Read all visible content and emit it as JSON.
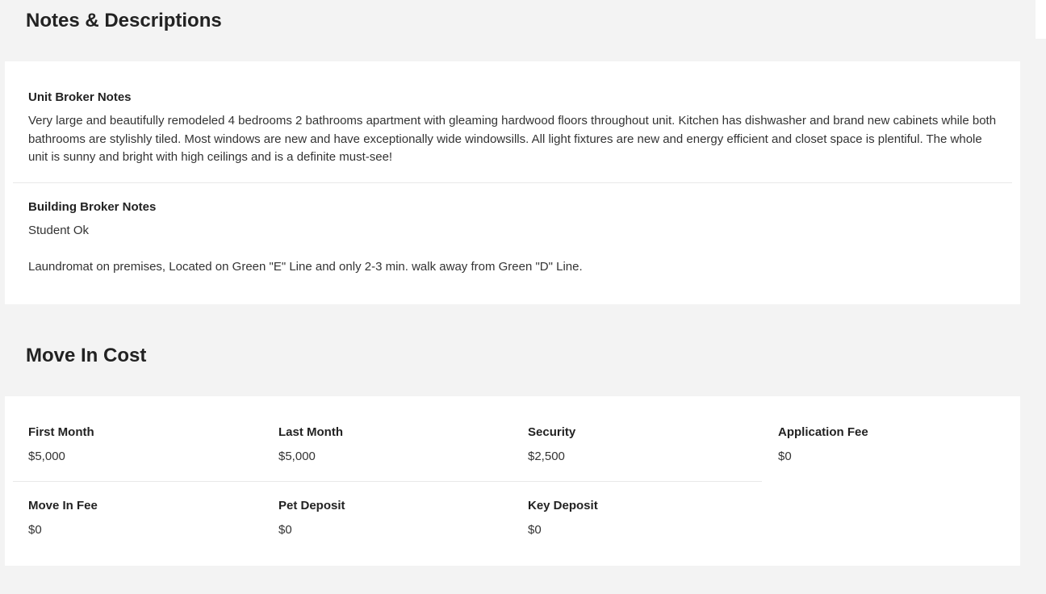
{
  "notes_section": {
    "title": "Notes & Descriptions",
    "unit_broker_notes": {
      "heading": "Unit Broker Notes",
      "text": "Very large and beautifully remodeled 4 bedrooms 2 bathrooms apartment with gleaming hardwood floors throughout unit. Kitchen has dishwasher and brand new cabinets while both bathrooms are stylishly tiled. Most windows are new and have exceptionally wide windowsills. All light fixtures are new and energy efficient and closet space is plentiful. The whole unit is sunny and bright with high ceilings and is a definite must-see!"
    },
    "building_broker_notes": {
      "heading": "Building Broker Notes",
      "line1": "Student Ok",
      "line2": "Laundromat on premises, Located on Green \"E\" Line and only 2-3 min. walk away from Green \"D\" Line."
    }
  },
  "move_in_section": {
    "title": "Move In Cost",
    "items": [
      {
        "label": "First Month",
        "value": "$5,000"
      },
      {
        "label": "Last Month",
        "value": "$5,000"
      },
      {
        "label": "Security",
        "value": "$2,500"
      },
      {
        "label": "Application Fee",
        "value": "$0"
      },
      {
        "label": "Move In Fee",
        "value": "$0"
      },
      {
        "label": "Pet Deposit",
        "value": "$0"
      },
      {
        "label": "Key Deposit",
        "value": "$0"
      }
    ]
  }
}
